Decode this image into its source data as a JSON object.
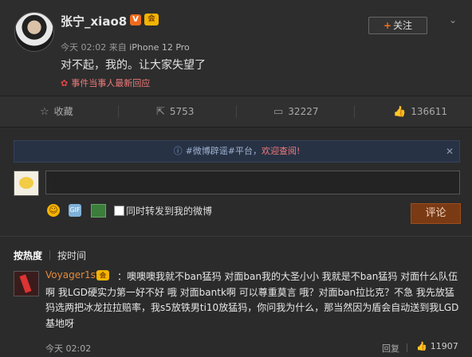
{
  "post": {
    "username": "张宁_xiao8",
    "verified_badge": "V",
    "member_badge": "会",
    "follow_label": "关注",
    "time": "今天 02:02",
    "source_prefix": "来自",
    "device": "iPhone 12 Pro",
    "content": "对不起，我的。让大家失望了",
    "event_link": "事件当事人最新回应"
  },
  "actions": {
    "collect_label": "收藏",
    "repost_count": "5753",
    "comment_count": "32227",
    "like_count": "136611"
  },
  "notice": {
    "prefix": "#微博辟谣#平台，",
    "link": "欢迎查阅!"
  },
  "composer": {
    "repost_checkbox_label": "同时转发到我的微博",
    "submit_label": "评论"
  },
  "sort": {
    "hot": "按热度",
    "time": "按时间"
  },
  "comment": {
    "username": "Voyager1st",
    "badge": "会",
    "text": "：噢噢噢我就不ban猛犸 对面ban我的大圣小小 我就是不ban猛犸 对面什么队伍啊 我LGD硬实力第一好不好 哦 对面bantk啊 可以尊重莫言 哦？对面ban拉比克？不急 我先放猛犸选两把冰龙拉拉赔率，我s5放铁男ti10放猛犸，你问我为什么，那当然因为盾会自动送到我LGD基地呀",
    "time": "今天 02:02",
    "reply_label": "回复",
    "likes": "11907"
  },
  "colors": {
    "accent": "#f26b1d",
    "username_orange": "#e58a3a",
    "event_red": "#f07a7a",
    "submit_bg": "#7a3a14",
    "notice_bg": "#283245"
  }
}
